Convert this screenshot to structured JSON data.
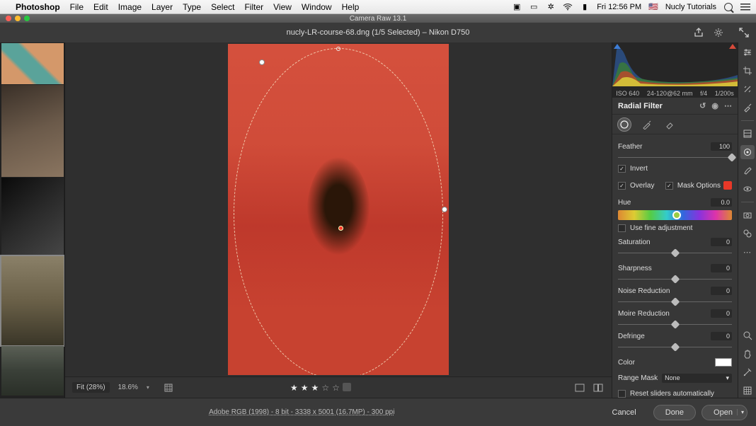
{
  "macmenu": {
    "appname": "Photoshop",
    "items": [
      "File",
      "Edit",
      "Image",
      "Layer",
      "Type",
      "Select",
      "Filter",
      "View",
      "Window",
      "Help"
    ],
    "clock": "Fri 12:56 PM",
    "flag": "🇺🇸",
    "account": "Nucly Tutorials"
  },
  "titlebar": "Camera Raw 13.1",
  "toolbar": {
    "filename": "nucly-LR-course-68.dng (1/5 Selected)  –  Nikon D750"
  },
  "exif": {
    "iso": "ISO 640",
    "focal": "24-120@62 mm",
    "aperture": "f/4",
    "shutter": "1/200s"
  },
  "panel": {
    "title": "Radial Filter",
    "feather": {
      "label": "Feather",
      "value": "100"
    },
    "invert": "Invert",
    "overlay": "Overlay",
    "mask_options": "Mask Options",
    "hue": {
      "label": "Hue",
      "value": "0.0"
    },
    "fine_adjust": "Use fine adjustment",
    "saturation": {
      "label": "Saturation",
      "value": "0"
    },
    "sharpness": {
      "label": "Sharpness",
      "value": "0"
    },
    "noise": {
      "label": "Noise Reduction",
      "value": "0"
    },
    "moire": {
      "label": "Moire Reduction",
      "value": "0"
    },
    "defringe": {
      "label": "Defringe",
      "value": "0"
    },
    "color": "Color",
    "range_mask": {
      "label": "Range Mask",
      "value": "None"
    },
    "reset_sliders": "Reset sliders automatically"
  },
  "zoom": {
    "fit": "Fit (28%)",
    "secondary": "18.6%"
  },
  "bottom": {
    "metadata": "Adobe RGB (1998) - 8 bit - 3338 x 5001 (16.7MP) - 300 ppi",
    "cancel": "Cancel",
    "done": "Done",
    "open": "Open"
  }
}
